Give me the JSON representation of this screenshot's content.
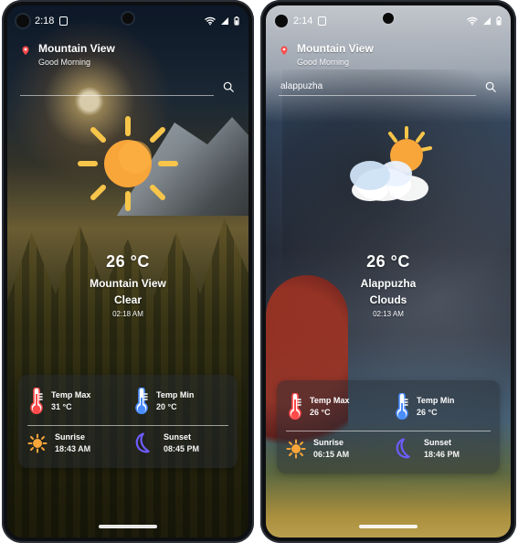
{
  "phones": [
    {
      "status": {
        "time": "2:18"
      },
      "header": {
        "city": "Mountain View",
        "greeting": "Good Morning"
      },
      "search": {
        "value": "",
        "placeholder": ""
      },
      "weather": {
        "temp": "26 °C",
        "location": "Mountain View",
        "condition": "Clear",
        "time": "02:18 AM"
      },
      "details": {
        "temp_max_label": "Temp Max",
        "temp_max_value": "31 °C",
        "temp_min_label": "Temp Min",
        "temp_min_value": "20 °C",
        "sunrise_label": "Sunrise",
        "sunrise_value": "18:43 AM",
        "sunset_label": "Sunset",
        "sunset_value": "08:45 PM"
      },
      "icons": {
        "location": "location-pin-icon",
        "search": "search-icon",
        "hero": "sun-icon"
      }
    },
    {
      "status": {
        "time": "2:14"
      },
      "header": {
        "city": "Mountain View",
        "greeting": "Good Morning"
      },
      "search": {
        "value": "alappuzha",
        "placeholder": ""
      },
      "weather": {
        "temp": "26 °C",
        "location": "Alappuzha",
        "condition": "Clouds",
        "time": "02:13 AM"
      },
      "details": {
        "temp_max_label": "Temp Max",
        "temp_max_value": "26 °C",
        "temp_min_label": "Temp Min",
        "temp_min_value": "26 °C",
        "sunrise_label": "Sunrise",
        "sunrise_value": "06:15 AM",
        "sunset_label": "Sunset",
        "sunset_value": "18:46 PM"
      },
      "icons": {
        "location": "location-pin-icon",
        "search": "search-icon",
        "hero": "cloud-sun-icon"
      }
    }
  ],
  "colors": {
    "pin_red": "#ff4b4b",
    "sun_orange": "#f8a53a",
    "sun_rays": "#f7c54a",
    "therm_red": "#ff4a4a",
    "therm_blue": "#4a8dff",
    "moon_purple": "#6d5cff"
  }
}
